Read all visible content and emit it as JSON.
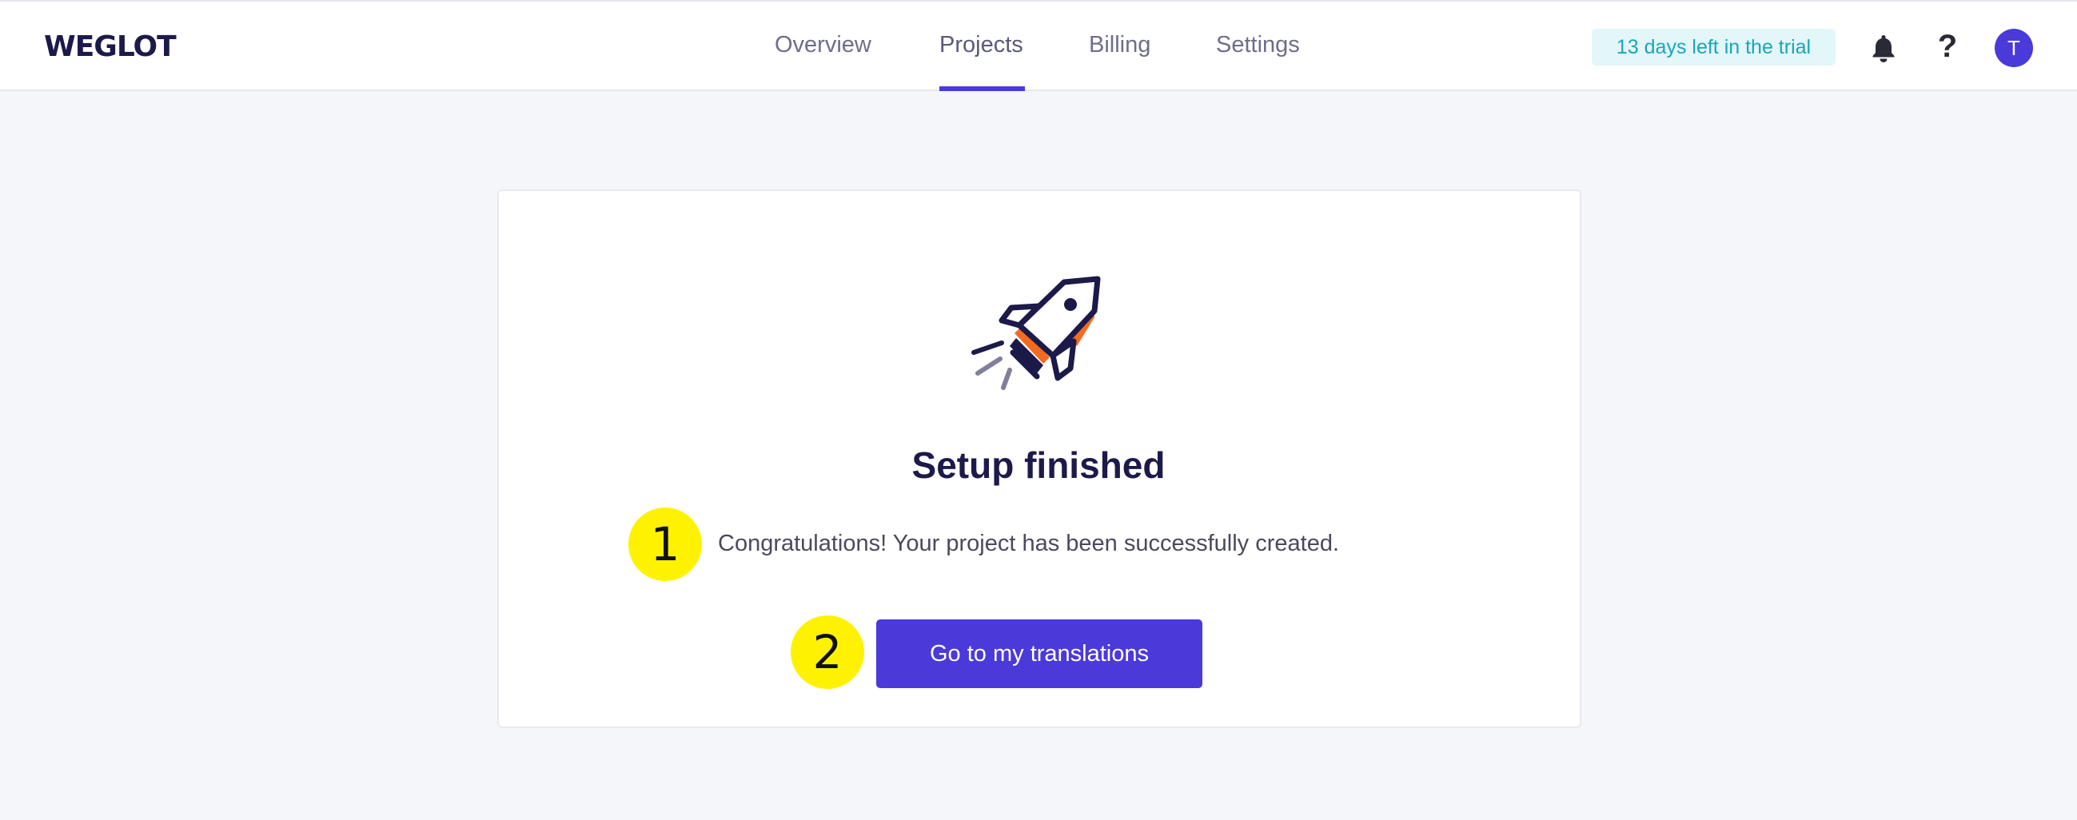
{
  "header": {
    "logo_text": "WEGLOT",
    "nav": [
      {
        "label": "Overview",
        "active": false
      },
      {
        "label": "Projects",
        "active": true
      },
      {
        "label": "Billing",
        "active": false
      },
      {
        "label": "Settings",
        "active": false
      }
    ],
    "trial_badge": "13 days left in the trial",
    "help_label": "?",
    "avatar_initial": "T",
    "icons": {
      "bell": "bell-icon",
      "help": "question-icon"
    }
  },
  "main": {
    "illustration": "rocket-icon",
    "title": "Setup finished",
    "message": "Congratulations! Your project has been successfully created.",
    "cta_label": "Go to my translations"
  },
  "annotations": {
    "step1": "1",
    "step2": "2"
  },
  "colors": {
    "accent": "#4a3ad9",
    "trial_bg": "#e3f6f8",
    "trial_text": "#1aa6b7",
    "highlight": "#fff200",
    "rocket_orange": "#f26b21",
    "title_text": "#1c1a4a"
  }
}
